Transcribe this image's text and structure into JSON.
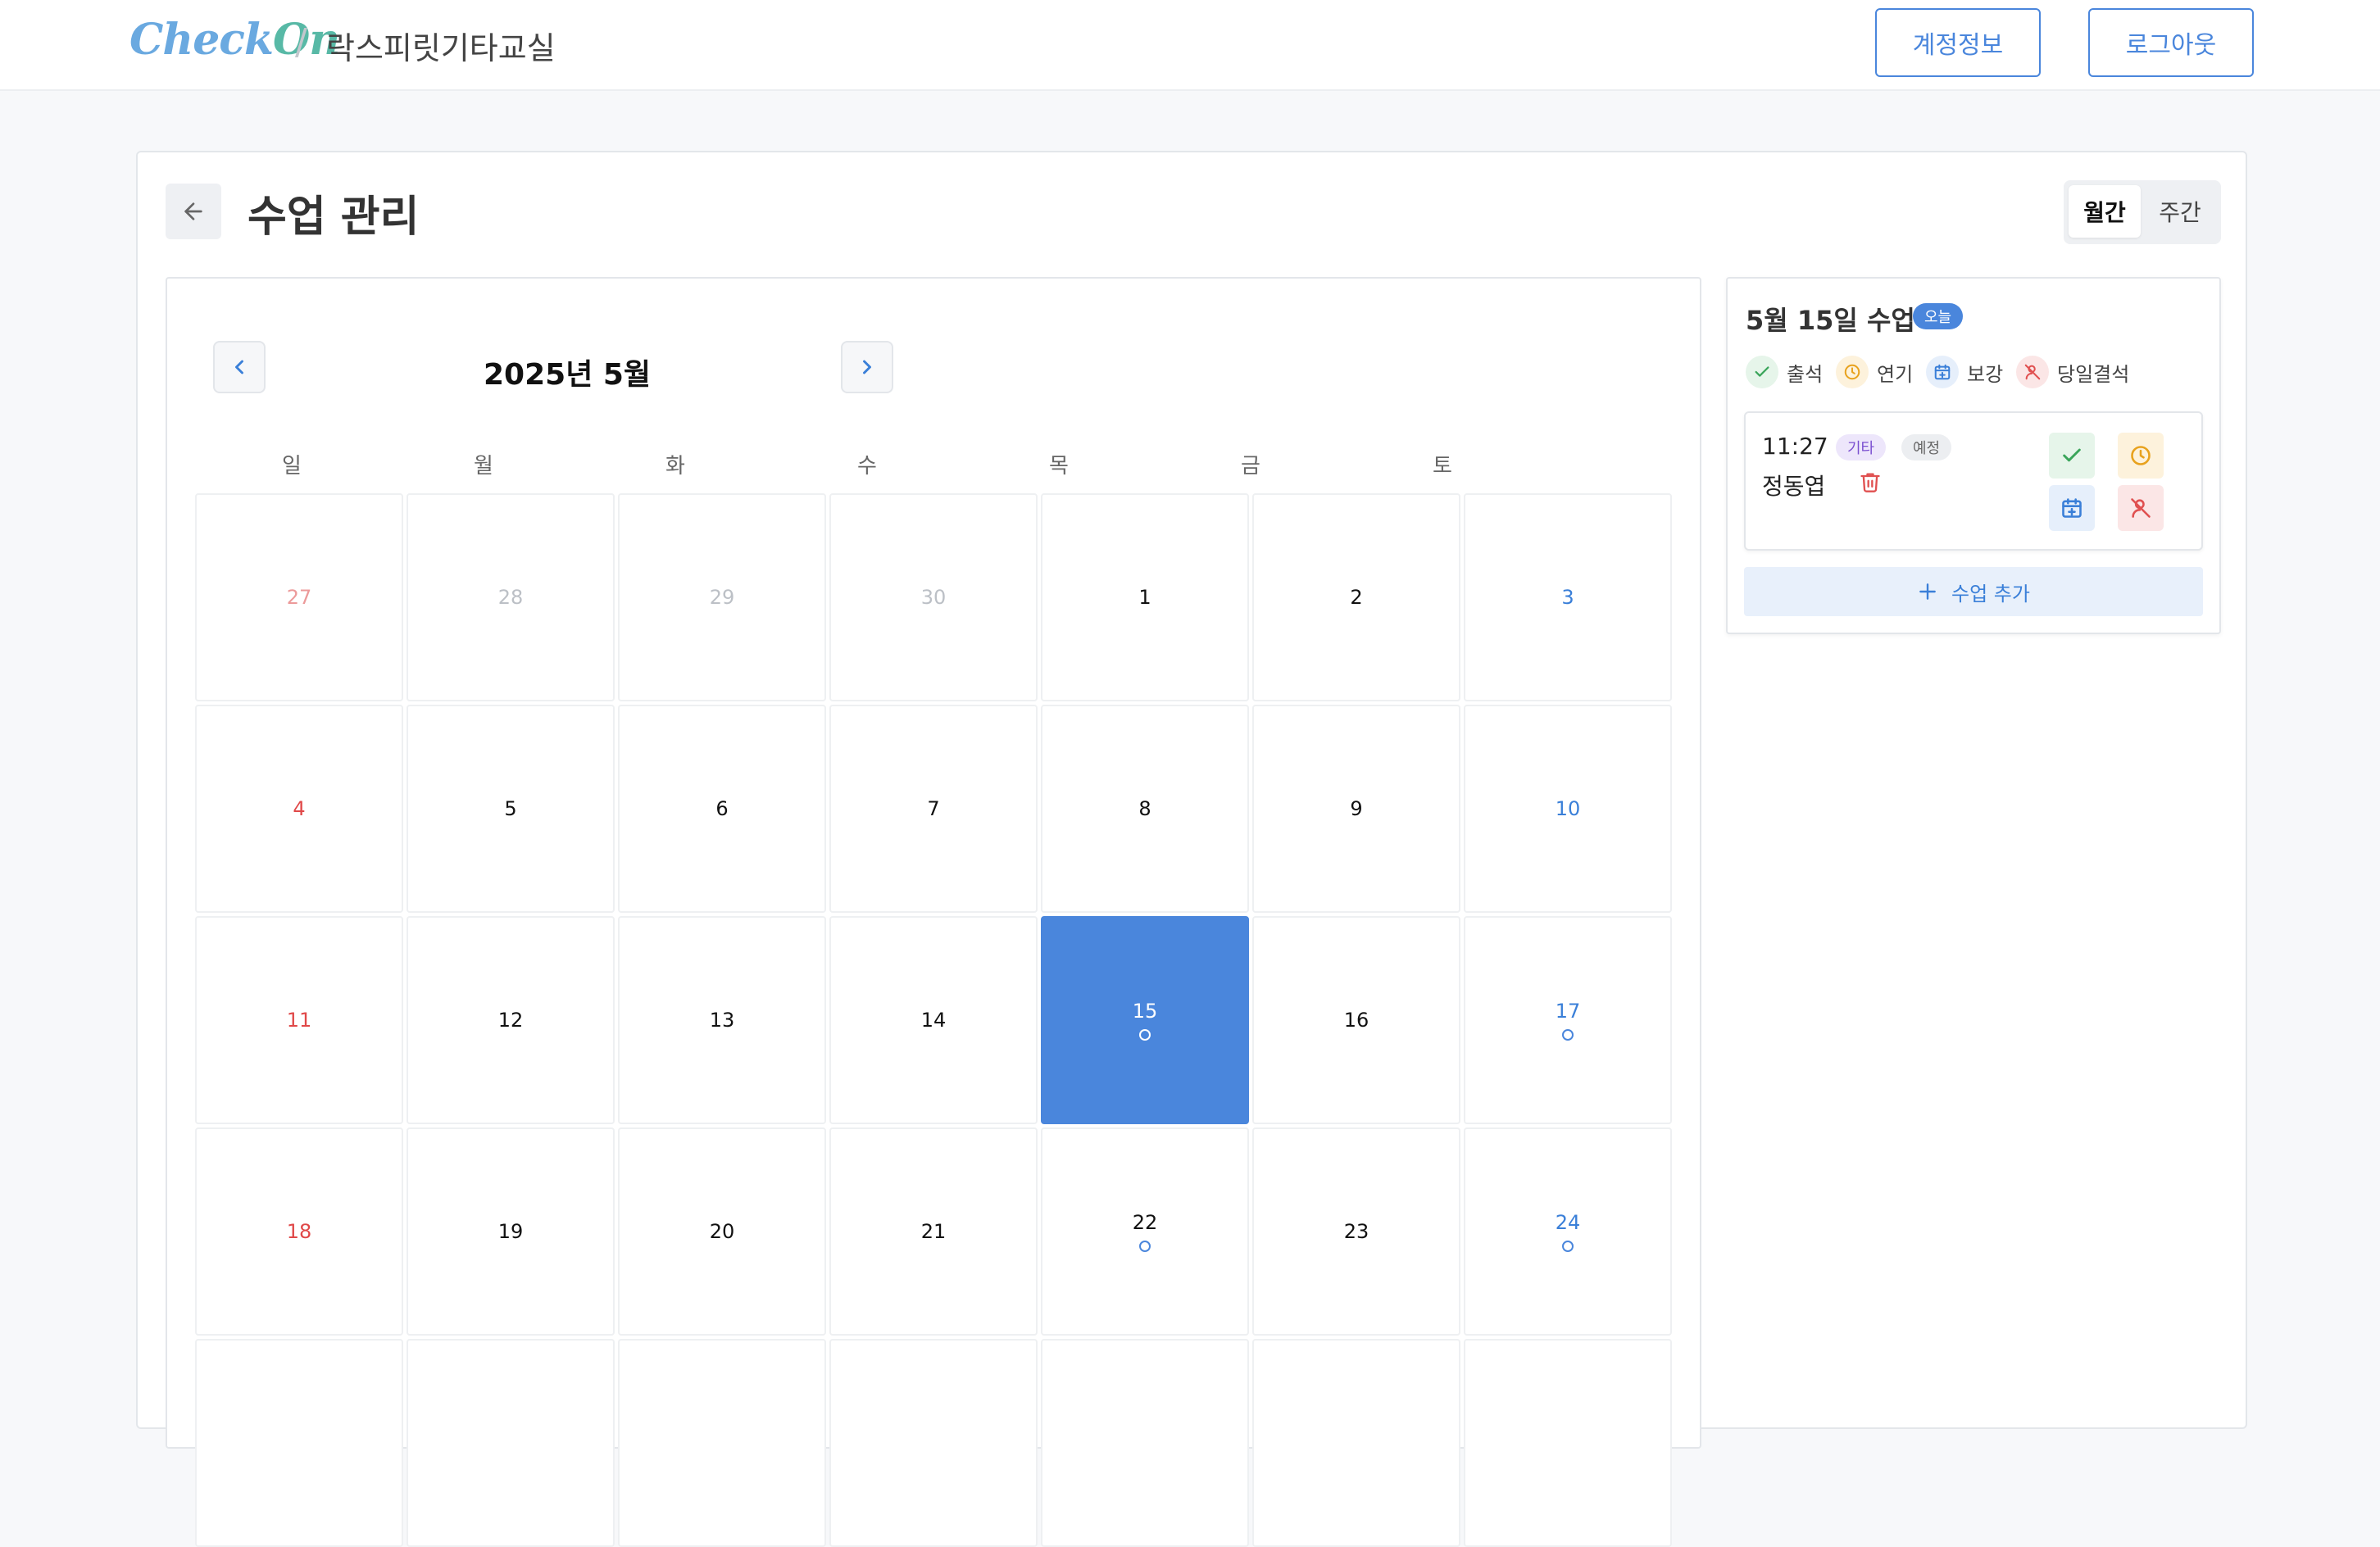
{
  "header": {
    "logo_part1": "Check",
    "logo_part2": "On",
    "separator": "/",
    "school_name": "락스피릿기타교실",
    "account_button": "계정정보",
    "logout_button": "로그아웃"
  },
  "page": {
    "title": "수업 관리",
    "view_tabs": [
      "월간",
      "주간"
    ],
    "active_view": "월간"
  },
  "calendar": {
    "month_label": "2025년 5월",
    "weekdays": [
      "일",
      "월",
      "화",
      "수",
      "목",
      "금",
      "토"
    ],
    "weeks": [
      [
        {
          "day": "27",
          "other": true
        },
        {
          "day": "28",
          "other": true
        },
        {
          "day": "29",
          "other": true
        },
        {
          "day": "30",
          "other": true
        },
        {
          "day": "1"
        },
        {
          "day": "2"
        },
        {
          "day": "3"
        }
      ],
      [
        {
          "day": "4"
        },
        {
          "day": "5"
        },
        {
          "day": "6"
        },
        {
          "day": "7"
        },
        {
          "day": "8"
        },
        {
          "day": "9"
        },
        {
          "day": "10"
        }
      ],
      [
        {
          "day": "11"
        },
        {
          "day": "12"
        },
        {
          "day": "13"
        },
        {
          "day": "14"
        },
        {
          "day": "15",
          "selected": true,
          "has_lesson": true
        },
        {
          "day": "16"
        },
        {
          "day": "17",
          "has_lesson": true
        }
      ],
      [
        {
          "day": "18"
        },
        {
          "day": "19"
        },
        {
          "day": "20"
        },
        {
          "day": "21"
        },
        {
          "day": "22",
          "has_lesson": true
        },
        {
          "day": "23"
        },
        {
          "day": "24",
          "has_lesson": true
        }
      ],
      [
        {
          "day": ""
        },
        {
          "day": ""
        },
        {
          "day": ""
        },
        {
          "day": ""
        },
        {
          "day": ""
        },
        {
          "day": ""
        },
        {
          "day": ""
        }
      ]
    ]
  },
  "side_panel": {
    "title": "5월 15일 수업",
    "today_badge": "오늘",
    "legend": [
      {
        "label": "출석",
        "icon": "check-icon",
        "color": "#3aa55a",
        "bg": "#e6f5ea"
      },
      {
        "label": "연기",
        "icon": "clock-icon",
        "color": "#e8a21e",
        "bg": "#fdf2dc"
      },
      {
        "label": "보강",
        "icon": "calendar-plus-icon",
        "color": "#3a7fd8",
        "bg": "#e6effb"
      },
      {
        "label": "당일결석",
        "icon": "user-x-icon",
        "color": "#e05050",
        "bg": "#fbe6e6"
      }
    ],
    "lesson": {
      "time": "11:27",
      "category_tag": "기타",
      "status_tag": "예정",
      "student": "정동엽"
    },
    "add_button": "수업 추가"
  },
  "colors": {
    "accent": "#4a86dc",
    "sunday": "#e04848",
    "saturday": "#3a7fd8"
  }
}
